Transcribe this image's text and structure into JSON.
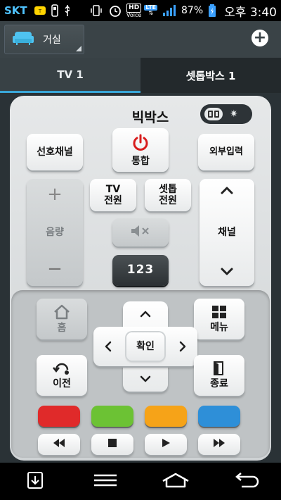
{
  "status_bar": {
    "carrier": "SKT",
    "hd_badge": "HD",
    "hd_sub": "Voice",
    "lte_badge": "LTE",
    "battery_percent": "87%",
    "time": "오후 3:40"
  },
  "room": {
    "label": "거실",
    "add_icon": "plus-icon"
  },
  "tabs": [
    {
      "label": "TV 1",
      "active": false
    },
    {
      "label": "셋톱박스 1",
      "active": true
    }
  ],
  "remote": {
    "title": "빅박스",
    "favorite_channel": "선호채널",
    "power_all_label": "통합",
    "external_input": "외부입력",
    "tv_power": [
      "TV",
      "전원"
    ],
    "settop_power": [
      "셋톱",
      "전원"
    ],
    "volume_label": "음량",
    "volume_plus": "+",
    "volume_minus": "−",
    "channel_label": "채널",
    "numpad_label": "123",
    "home_label": "홈",
    "menu_label": "메뉴",
    "ok_label": "확인",
    "back_label": "이전",
    "exit_label": "종료"
  },
  "colors": {
    "red": "#e02a2a",
    "green": "#6cc234",
    "yellow": "#f6a318",
    "blue": "#2e8fd8",
    "tab_underline": "#3aa7d8"
  }
}
